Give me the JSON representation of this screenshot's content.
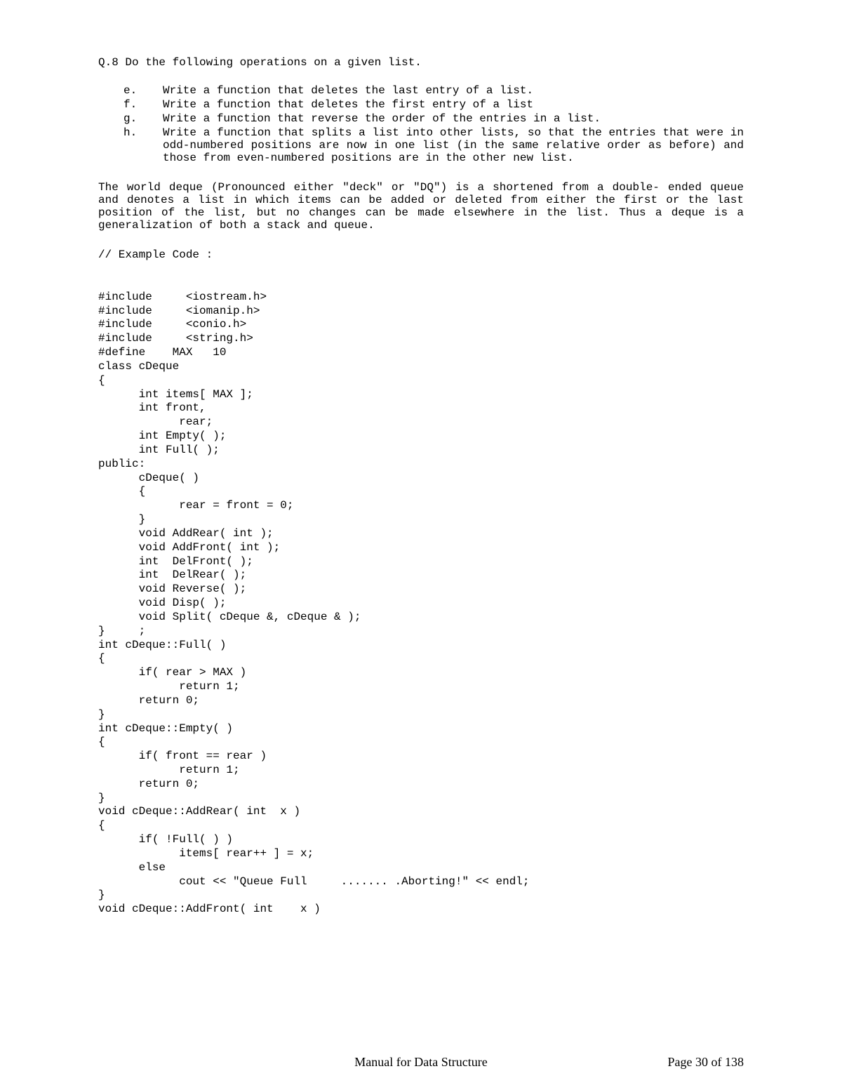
{
  "question": {
    "number": "Q.8",
    "prompt": "Do the following operations on a given list."
  },
  "subitems": [
    {
      "marker": "e.",
      "text": "Write a function that deletes the last entry of a list."
    },
    {
      "marker": "f.",
      "text": "Write a function that deletes the first entry of a list"
    },
    {
      "marker": "g.",
      "text": "Write a function that reverse the order of the entries in a list."
    },
    {
      "marker": "h.",
      "text": "Write a function that splits a list into other lists, so that the entries that were in odd-numbered positions are now in one list (in the same relative order as before) and those from even-numbered positions are in the other new list."
    }
  ],
  "paragraph": "The world deque (Pronounced either \"deck\" or \"DQ\") is a shortened from a double- ended queue and denotes a list in which items can be added or deleted from either the first or the last position of the list, but no changes can be made elsewhere in the list. Thus a deque is a generalization of both a stack and queue.",
  "code_comment": "// Example Code :",
  "code": "#include     <iostream.h>\n#include     <iomanip.h>\n#include     <conio.h>\n#include     <string.h>\n#define    MAX   10\nclass cDeque\n{\n      int items[ MAX ];\n      int front,\n            rear;\n      int Empty( );\n      int Full( );\npublic:\n      cDeque( )\n      {\n            rear = front = 0;\n      }\n      void AddRear( int );\n      void AddFront( int );\n      int  DelFront( );\n      int  DelRear( );\n      void Reverse( );\n      void Disp( );\n      void Split( cDeque &, cDeque & );\n}     ;\nint cDeque::Full( )\n{\n      if( rear > MAX )\n            return 1;\n      return 0;\n}\nint cDeque::Empty( )\n{\n      if( front == rear )\n            return 1;\n      return 0;\n}\nvoid cDeque::AddRear( int  x )\n{\n      if( !Full( ) )\n            items[ rear++ ] = x;\n      else\n            cout << \"Queue Full     ....... .Aborting!\" << endl;\n}\nvoid cDeque::AddFront( int    x )",
  "footer": {
    "center": "Manual for Data Structure",
    "right": "Page 30 of 138"
  }
}
